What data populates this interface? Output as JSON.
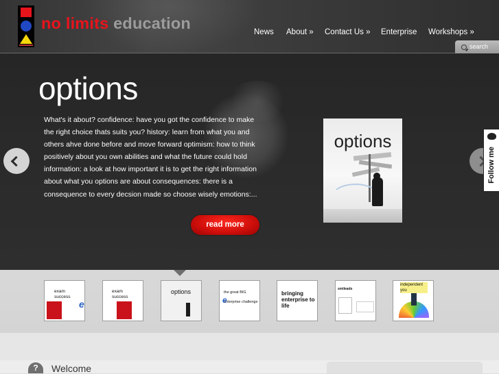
{
  "brand": {
    "name_part1": "no limits",
    "name_part2": "education",
    "colors": {
      "red": "#e8141c",
      "blue": "#2148c4",
      "yellow": "#f4d80b",
      "grey": "#9c9c9c"
    }
  },
  "nav": {
    "items": [
      {
        "label": "News"
      },
      {
        "label": "About »"
      },
      {
        "label": "Contact Us »"
      },
      {
        "label": "Enterprise"
      },
      {
        "label": "Workshops »"
      }
    ]
  },
  "search": {
    "placeholder": "search",
    "icon": "search-icon"
  },
  "hero": {
    "title": "options",
    "text": "What's it about? confidence: have you got the confidence to make the right choice thats suits you? history: learn from what you and others ahve done before and move forward optimism: how to think positively about you own abilities and what the future could hold information: a look at how important it is to get the right information about what you options are about consequences: there is a consequence to every decsion made so choose wisely emotions:...",
    "read_more": "read more",
    "image_word": "options",
    "accent": "#d10f0b"
  },
  "follow": {
    "label": "Follow me",
    "icon": "bird-icon"
  },
  "thumbnails": [
    {
      "caption": "exam success",
      "letter": "e"
    },
    {
      "caption": "exam success",
      "letter": ""
    },
    {
      "caption": "options",
      "letter": ""
    },
    {
      "caption": "the great BIG enterprise challenge",
      "letter": "e"
    },
    {
      "caption": "bringing enterprise to life",
      "letter": ""
    },
    {
      "caption": "smileads",
      "letter": ""
    },
    {
      "caption": "independent you",
      "letter": ""
    }
  ],
  "welcome": {
    "title": "Welcome",
    "icon_glyph": "?"
  }
}
